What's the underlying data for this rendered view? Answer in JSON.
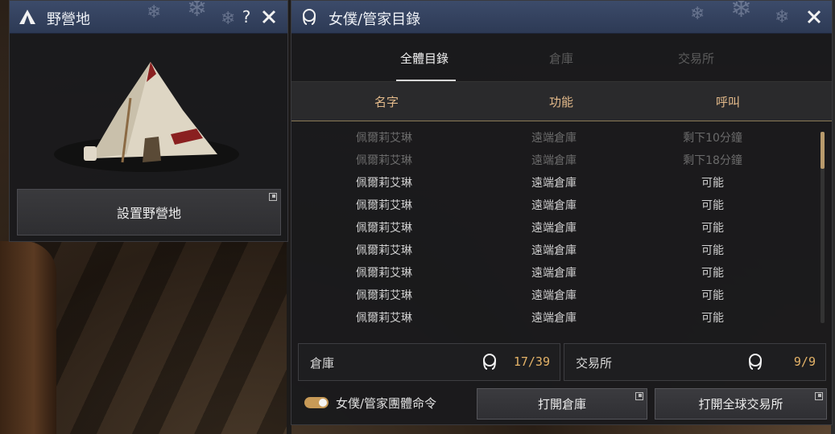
{
  "camp": {
    "title": "野營地",
    "help": "?",
    "setup_button": "設置野營地"
  },
  "maid": {
    "title": "女僕/管家目錄",
    "tabs": [
      "全體目錄",
      "倉庫",
      "交易所"
    ],
    "active_tab": 0,
    "headers": [
      "名字",
      "功能",
      "呼叫"
    ],
    "rows": [
      {
        "name": "佩爾莉艾琳",
        "function": "遠端倉庫",
        "call": "剩下10分鐘",
        "available": false
      },
      {
        "name": "佩爾莉艾琳",
        "function": "遠端倉庫",
        "call": "剩下18分鐘",
        "available": false
      },
      {
        "name": "佩爾莉艾琳",
        "function": "遠端倉庫",
        "call": "可能",
        "available": true
      },
      {
        "name": "佩爾莉艾琳",
        "function": "遠端倉庫",
        "call": "可能",
        "available": true
      },
      {
        "name": "佩爾莉艾琳",
        "function": "遠端倉庫",
        "call": "可能",
        "available": true
      },
      {
        "name": "佩爾莉艾琳",
        "function": "遠端倉庫",
        "call": "可能",
        "available": true
      },
      {
        "name": "佩爾莉艾琳",
        "function": "遠端倉庫",
        "call": "可能",
        "available": true
      },
      {
        "name": "佩爾莉艾琳",
        "function": "遠端倉庫",
        "call": "可能",
        "available": true
      },
      {
        "name": "佩爾莉艾琳",
        "function": "遠端倉庫",
        "call": "可能",
        "available": true
      }
    ],
    "warehouse": {
      "label": "倉庫",
      "count": "17/39"
    },
    "market": {
      "label": "交易所",
      "count": "9/9"
    },
    "group_command": "女僕/管家團體命令",
    "open_warehouse": "打開倉庫",
    "open_market": "打開全球交易所"
  },
  "colors": {
    "accent": "#e4b368",
    "header_text": "#e2b98a",
    "title_bar": "#34425f"
  }
}
